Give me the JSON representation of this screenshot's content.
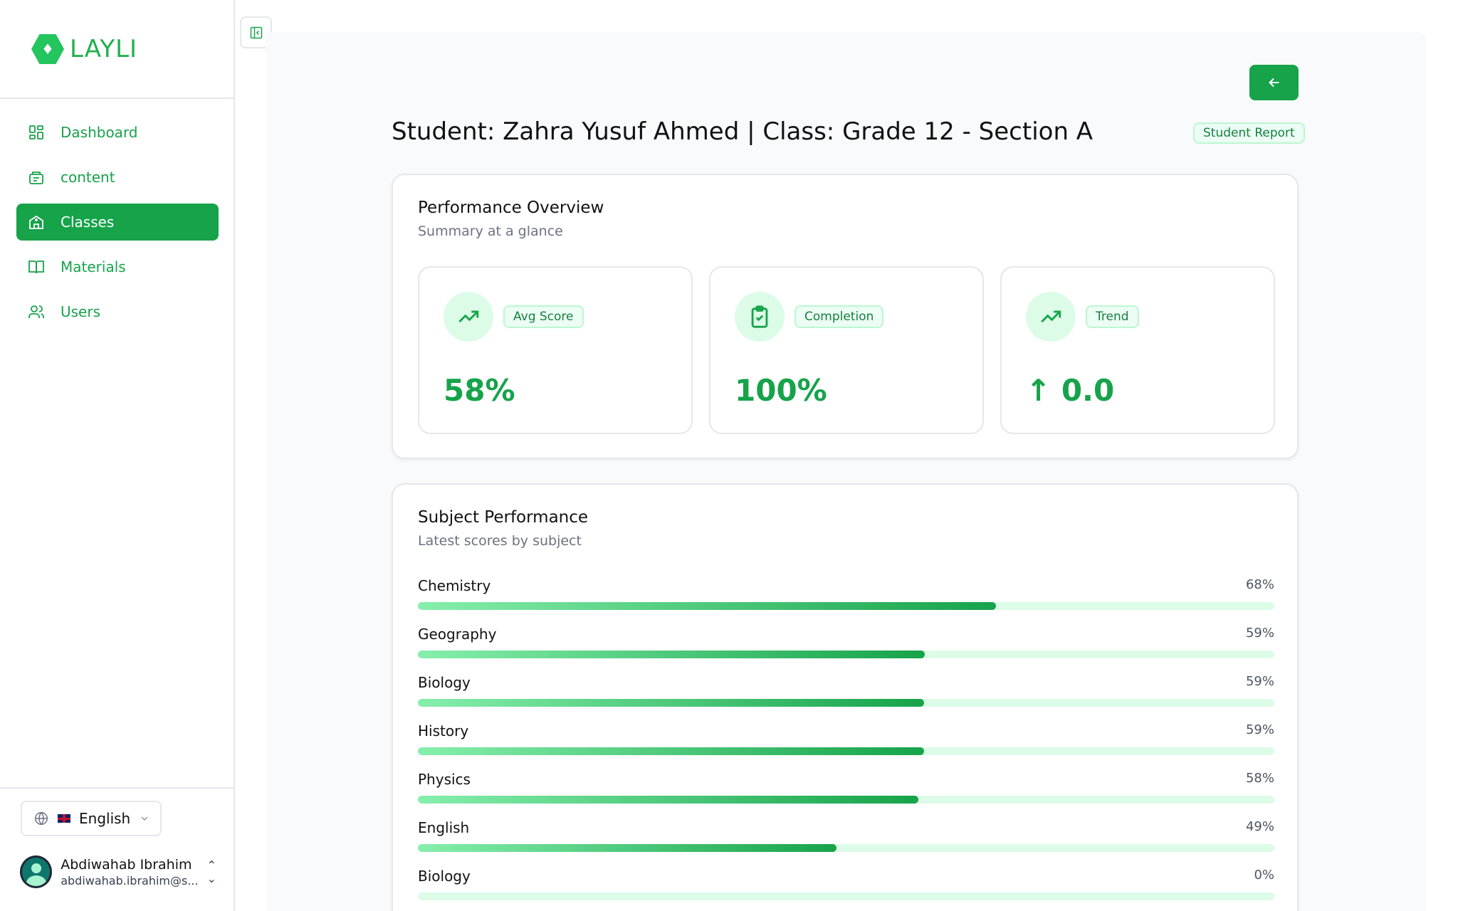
{
  "app": {
    "logo_text": "LAYLI"
  },
  "sidebar": {
    "items": [
      {
        "label": "Dashboard",
        "icon": "dashboard-icon",
        "active": false
      },
      {
        "label": "content",
        "icon": "content-icon",
        "active": false
      },
      {
        "label": "Classes",
        "icon": "school-icon",
        "active": true
      },
      {
        "label": "Materials",
        "icon": "book-icon",
        "active": false
      },
      {
        "label": "Users",
        "icon": "users-icon",
        "active": false
      }
    ],
    "language": "English",
    "user": {
      "name": "Abdiwahab Ibrahim",
      "email": "abdiwahab.ibrahim@s..."
    }
  },
  "header": {
    "title": "Student: Zahra Yusuf Ahmed | Class: Grade 12 - Section A",
    "badge": "Student Report"
  },
  "overview": {
    "title": "Performance Overview",
    "subtitle": "Summary at a glance",
    "stats": [
      {
        "label": "Avg Score",
        "value": "58%",
        "icon": "trending-up-icon"
      },
      {
        "label": "Completion",
        "value": "100%",
        "icon": "clipboard-check-icon"
      },
      {
        "label": "Trend",
        "value": "↑ 0.0",
        "icon": "trending-up-icon"
      }
    ]
  },
  "subjects": {
    "title": "Subject Performance",
    "subtitle": "Latest scores by subject",
    "items": [
      {
        "name": "Chemistry",
        "percent_label": "68%",
        "progress": 0.675
      },
      {
        "name": "Geography",
        "percent_label": "59%",
        "progress": 0.592
      },
      {
        "name": "Biology",
        "percent_label": "59%",
        "progress": 0.591
      },
      {
        "name": "History",
        "percent_label": "59%",
        "progress": 0.591
      },
      {
        "name": "Physics",
        "percent_label": "58%",
        "progress": 0.584
      },
      {
        "name": "English",
        "percent_label": "49%",
        "progress": 0.489
      },
      {
        "name": "Biology",
        "percent_label": "0%",
        "progress": 0
      }
    ]
  },
  "colors": {
    "accent": "#16a34a",
    "accent_light": "#dcfce7",
    "panel_bg": "#f9fafb"
  }
}
